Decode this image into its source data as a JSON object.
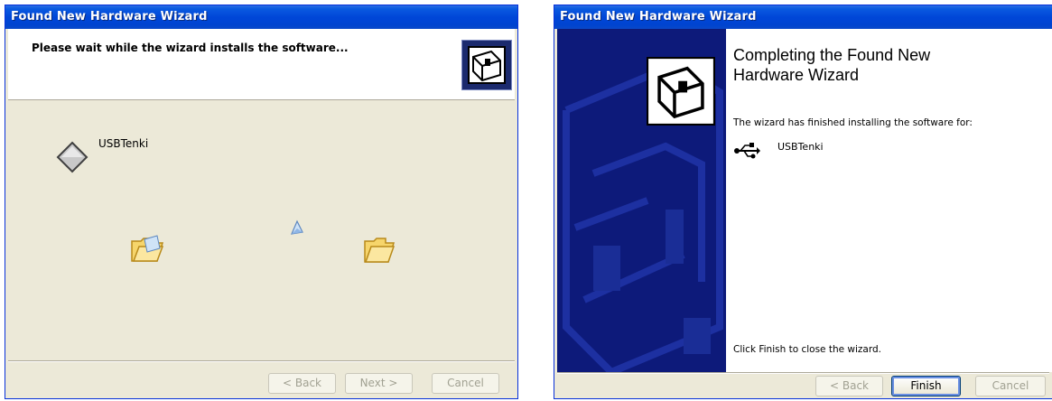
{
  "wizard_left": {
    "title": "Found New Hardware Wizard",
    "header_text": "Please wait while the wizard installs the software...",
    "device_name": "USBTenki",
    "buttons": {
      "back": "< Back",
      "next": "Next >",
      "cancel": "Cancel"
    }
  },
  "wizard_right": {
    "title": "Found New Hardware Wizard",
    "heading": "Completing the Found New Hardware Wizard",
    "finished_text": "The wizard has finished installing the software for:",
    "device_name": "USBTenki",
    "close_text": "Click Finish to close the wizard.",
    "buttons": {
      "back": "< Back",
      "finish": "Finish",
      "cancel": "Cancel"
    }
  }
}
